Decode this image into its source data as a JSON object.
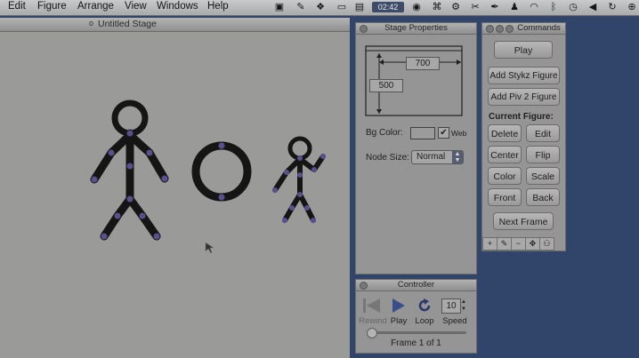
{
  "menubar": {
    "items": [
      "Edit",
      "Figure",
      "Arrange",
      "View",
      "Windows",
      "Help"
    ],
    "clock": "02:42"
  },
  "stage_window": {
    "title": "Untitled Stage"
  },
  "stage_properties": {
    "title": "Stage Properties",
    "width_value": "700",
    "height_value": "500",
    "bg_color_label": "Bg Color:",
    "web_label": "Web",
    "web_checked": true,
    "node_size_label": "Node Size:",
    "node_size_value": "Normal"
  },
  "commands": {
    "title": "Commands",
    "play": "Play",
    "add_stykz": "Add Stykz Figure",
    "add_piv2": "Add Piv 2 Figure",
    "current_figure_label": "Current Figure:",
    "delete": "Delete",
    "edit": "Edit",
    "center": "Center",
    "flip": "Flip",
    "color": "Color",
    "scale": "Scale",
    "front": "Front",
    "back": "Back",
    "next_frame": "Next Frame"
  },
  "controller": {
    "title": "Controller",
    "rewind_label": "Rewind",
    "play_label": "Play",
    "loop_label": "Loop",
    "speed_value": "10",
    "speed_label": "Speed",
    "frame_label": "Frame 1 of 1",
    "slider_position": 0
  },
  "colors": {
    "desktop": "#31456b",
    "figure_fill": "#151515",
    "node_color": "#5b4f8e"
  }
}
